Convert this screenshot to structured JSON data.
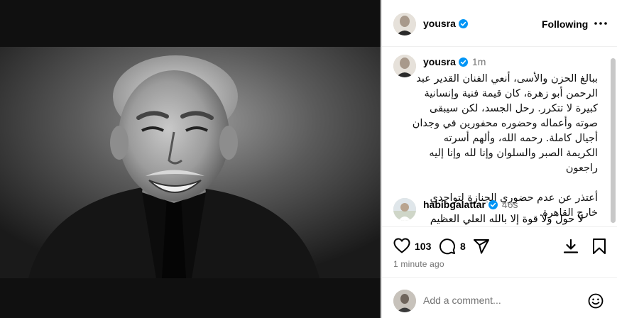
{
  "post_author": {
    "username": "yousra",
    "follow_status": "Following"
  },
  "caption": {
    "username": "yousra",
    "time": "1m",
    "paragraphs": [
      "ببالغ الحزن والأسى، أنعي الفنان القدير عبد الرحمن أبو زهرة، كان قيمة فنية وإنسانية كبيرة لا تتكرر. رحل الجسد، لكن سيبقى صوته وأعماله وحضوره محفورين في وجدان أجيال كاملة. رحمه الله، وألهم أسرته الكريمة الصبر والسلوان وإنا لله وإنا إليه راجعون",
      "أعتذر عن عدم حضوري الجنازة لتواجدي خارج القاهرة."
    ]
  },
  "comment": {
    "username": "habibgalattar",
    "time": "46s",
    "text": "لا حول ولا قوة إلا بالله العلي العظيم"
  },
  "stats": {
    "likes": "103",
    "comments": "8",
    "time_ago": "1 minute ago"
  },
  "add_comment": {
    "placeholder": "Add a comment..."
  },
  "icons": {
    "like": "heart-icon",
    "comment": "comment-icon",
    "share": "paper-plane-icon",
    "download": "download-icon",
    "save": "bookmark-icon",
    "more": "more-horizontal-icon",
    "emoji": "emoji-icon",
    "verified": "verified-badge-icon"
  },
  "colors": {
    "verified_blue": "#0095f6",
    "secondary_text": "#737373",
    "divider": "#efefef"
  }
}
